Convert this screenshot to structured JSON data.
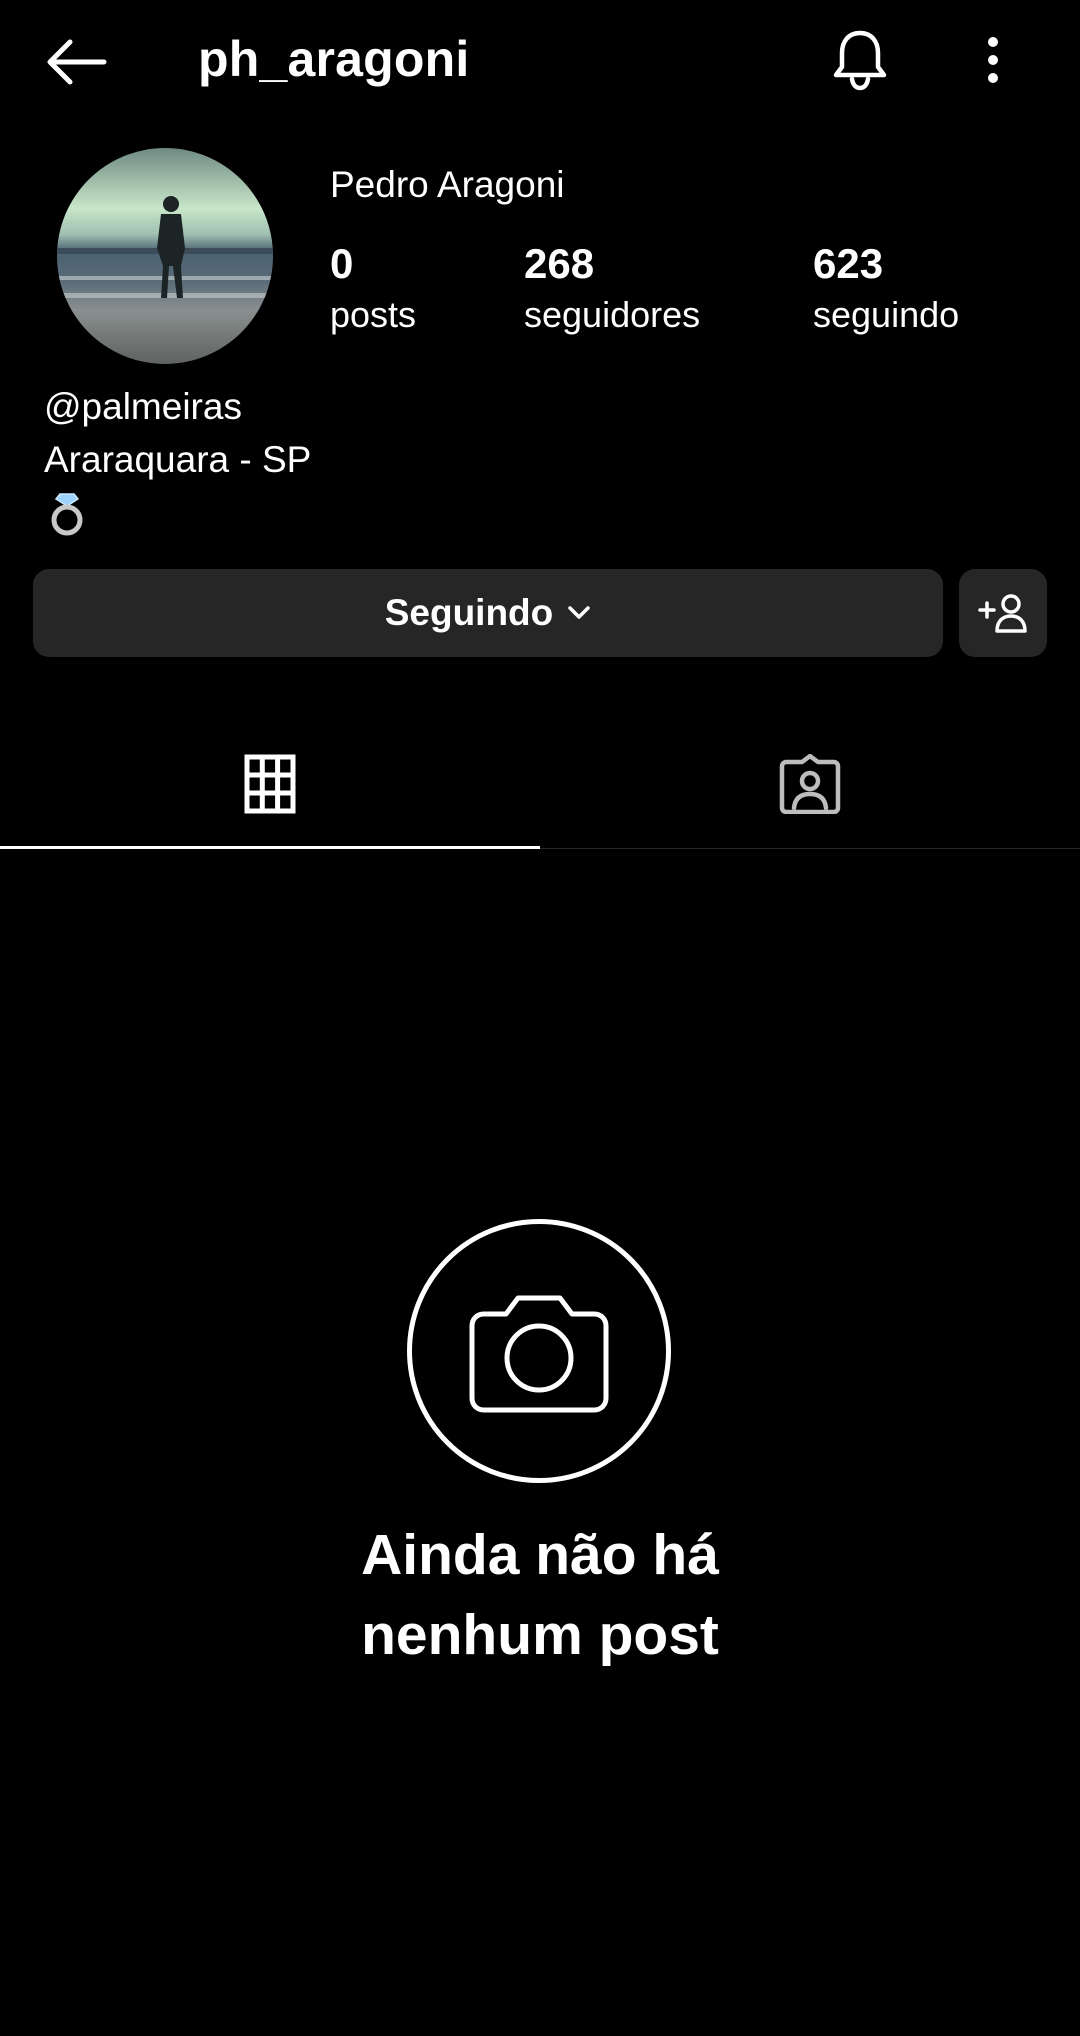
{
  "header": {
    "username": "ph_aragoni"
  },
  "profile": {
    "display_name": "Pedro Aragoni",
    "stats": {
      "posts": {
        "value": "0",
        "label": "posts"
      },
      "followers": {
        "value": "268",
        "label": "seguidores"
      },
      "following": {
        "value": "623",
        "label": "seguindo"
      }
    },
    "bio": {
      "line1": "@palmeiras",
      "line2": "Araraquara - SP",
      "emoji": "💍"
    }
  },
  "actions": {
    "follow_state_label": "Seguindo"
  },
  "empty_state": {
    "line1": "Ainda não há",
    "line2": "nenhum post"
  },
  "colors": {
    "background": "#000000",
    "button_bg": "#262626",
    "text": "#ffffff"
  }
}
